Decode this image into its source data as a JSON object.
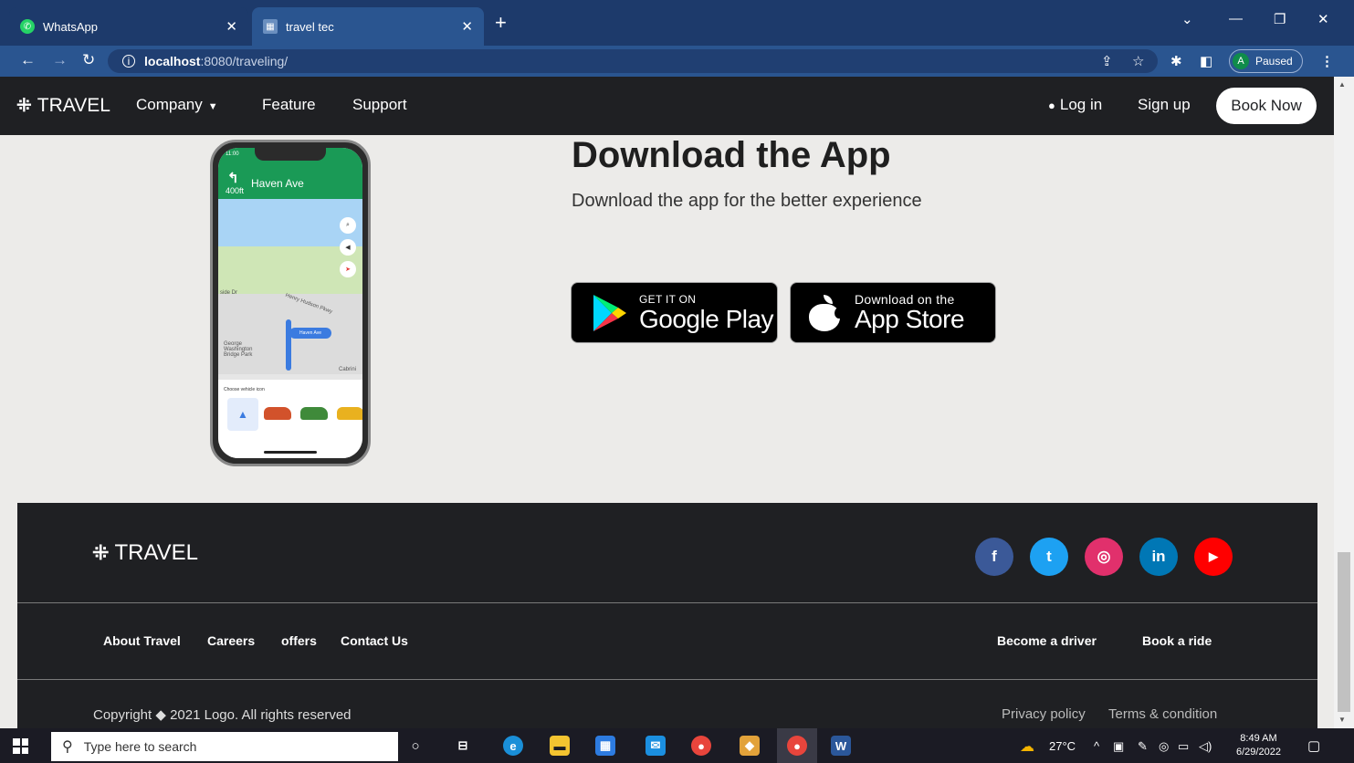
{
  "browser": {
    "tabs": [
      {
        "title": "WhatsApp",
        "icon": "whatsapp-icon"
      },
      {
        "title": "travel tec",
        "icon": "site-favicon"
      }
    ],
    "url_host": "localhost",
    "url_path": ":8080/traveling/",
    "profile_initial": "A",
    "profile_status": "Paused"
  },
  "nav": {
    "brand": "TRAVEL",
    "links": [
      "Company",
      "Feature",
      "Support"
    ],
    "login": "Log in",
    "signup": "Sign up",
    "book_now": "Book Now"
  },
  "phone": {
    "time": "11:00",
    "distance": "400ft",
    "street": "Haven Ave",
    "map_labels": [
      "side Dr",
      "Henry Hudson Pkwy",
      "George Washington Bridge Park",
      "Cabrini"
    ],
    "nav_pill": "Haven Ave",
    "vehicle_title": "Choose vehicle icon"
  },
  "download": {
    "title": "Download the App",
    "subtitle": "Download the app for the better experience",
    "google_small": "GET IT ON",
    "google_big": "Google Play",
    "apple_small": "Download on the",
    "apple_big": "App Store"
  },
  "footer": {
    "brand": "TRAVEL",
    "social": [
      {
        "name": "facebook",
        "glyph": "f",
        "color": "#3b5998"
      },
      {
        "name": "twitter",
        "glyph": "t",
        "color": "#1da1f2"
      },
      {
        "name": "instagram",
        "glyph": "◎",
        "color": "#e1306c"
      },
      {
        "name": "linkedin",
        "glyph": "in",
        "color": "#0077b5"
      },
      {
        "name": "youtube",
        "glyph": "▶",
        "color": "#ff0000"
      }
    ],
    "links_left": [
      "About Travel",
      "Careers",
      "offers",
      "Contact Us"
    ],
    "links_right": [
      "Become a driver",
      "Book a ride"
    ],
    "copyright": "Copyright ◆ 2021 Logo.  All rights reserved",
    "privacy": "Privacy policy",
    "terms": "Terms & condition"
  },
  "taskbar": {
    "search_placeholder": "Type here to search",
    "temperature": "27°C",
    "time": "8:49 AM",
    "date": "6/29/2022"
  },
  "colors": {
    "browser_tab_bg": "#1d3a6b",
    "navbar_bg": "#1f2023",
    "page_bg": "#ecebe9"
  }
}
